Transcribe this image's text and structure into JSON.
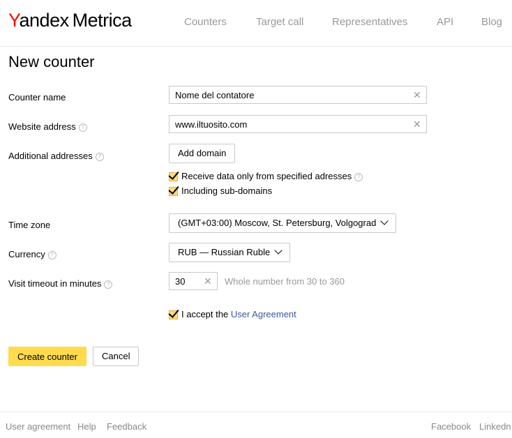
{
  "header": {
    "logo": {
      "first_letter": "Y",
      "rest": "andex",
      "product": "Metrica"
    },
    "nav": [
      "Counters",
      "Target call",
      "Representatives",
      "API",
      "Blog"
    ]
  },
  "page": {
    "title": "New counter"
  },
  "form": {
    "counter_name": {
      "label": "Counter name",
      "value": "Nome del contatore"
    },
    "website_address": {
      "label": "Website address",
      "value": "www.iltuosito.com"
    },
    "additional_addresses": {
      "label": "Additional addresses",
      "add_button": "Add domain",
      "checkbox_specified": "Receive data only from specified adresses",
      "checkbox_subdomains": "Including sub-domains"
    },
    "time_zone": {
      "label": "Time zone",
      "value": "(GMT+03:00) Moscow, St. Petersburg, Volgograd"
    },
    "currency": {
      "label": "Currency",
      "value": "RUB — Russian Ruble"
    },
    "visit_timeout": {
      "label": "Visit timeout in minutes",
      "value": "30",
      "hint": "Whole number from 30 to 360"
    },
    "agreement": {
      "text": "I accept the ",
      "link": "User Agreement"
    },
    "create_button": "Create counter",
    "cancel_button": "Cancel"
  },
  "icons": {
    "help": "?",
    "clear": "✕"
  },
  "footer": {
    "left": [
      "User agreement",
      "Help",
      "Feedback"
    ],
    "right": [
      "Facebook",
      "Linkedn"
    ]
  },
  "colors": {
    "brand_red": "#ff0000",
    "primary_button": "#ffdb4d",
    "checkbox": "#ffd97a",
    "link": "#3a58a0"
  }
}
